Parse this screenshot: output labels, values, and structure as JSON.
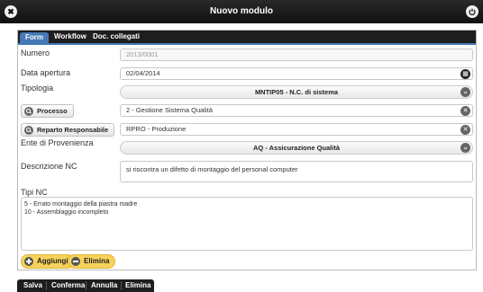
{
  "window": {
    "title": "Nuovo modulo",
    "close_glyph": "✖"
  },
  "tabs": [
    "Form",
    "Workflow",
    "Doc. collegati"
  ],
  "form": {
    "numero_label": "Numero",
    "numero_value": "2013/0001",
    "data_label": "Data apertura",
    "data_value": "02/04/2014",
    "tipologia_label": "Tipologia",
    "tipologia_value": "MNTIP05 - N.C. di sistema",
    "processo_button": "Processo",
    "processo_value": "2 - Gestione Sistema Qualità",
    "reparto_button": "Reparto Responsabile",
    "reparto_value": "RPRO - Produzione",
    "ente_label": "Ente di Provenienza",
    "ente_value": "AQ - Assicurazione Qualità",
    "descrizione_label": "Descrizione NC",
    "descrizione_value": "si riscontra un difetto di montaggio del personal computer",
    "tipi_label": "Tipi NC",
    "tipi_items": [
      "5 - Errato montaggio della piastra madre",
      "10 - Assemblaggio incompleto"
    ]
  },
  "list_actions": {
    "add": "Aggiungi",
    "remove": "Elimina"
  },
  "bottom_actions": [
    "Salva",
    "Conferma",
    "Annulla",
    "Elimina"
  ],
  "colors": {
    "accent_tab": "#4579b5",
    "yellow_button": "#f7d35a",
    "bar": "#1e1e1e"
  }
}
